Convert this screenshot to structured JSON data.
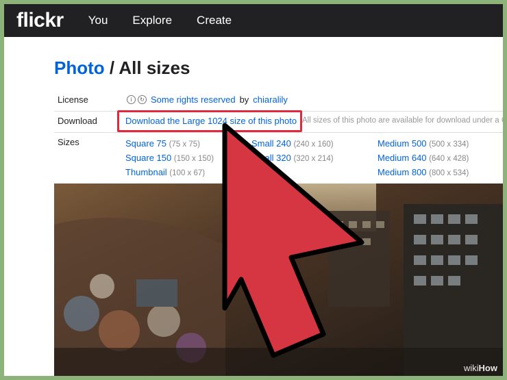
{
  "nav": {
    "logo": "flickr",
    "items": [
      "You",
      "Explore",
      "Create"
    ]
  },
  "page": {
    "title_link": "Photo",
    "title_sep": " / ",
    "title_rest": "All sizes"
  },
  "license": {
    "label": "License",
    "icons": [
      "cc-attribution-icon",
      "cc-sharealike-icon"
    ],
    "link": "Some rights reserved",
    "by": "by",
    "author": "chiaralily"
  },
  "download": {
    "label": "Download",
    "link": "Download the Large 1024 size of this photo",
    "note": "All sizes of this photo are available for download under a C"
  },
  "sizes": {
    "label": "Sizes",
    "columns": [
      [
        {
          "name": "Square 75",
          "dims": "(75 x 75)"
        },
        {
          "name": "Square 150",
          "dims": "(150 x 150)"
        },
        {
          "name": "Thumbnail",
          "dims": "(100 x 67)"
        }
      ],
      [
        {
          "name": "Small 240",
          "dims": "(240 x 160)"
        },
        {
          "name": "Small 320",
          "dims": "(320 x 214)"
        }
      ],
      [
        {
          "name": "Medium 500",
          "dims": "(500 x 334)"
        },
        {
          "name": "Medium 640",
          "dims": "(640 x 428)"
        },
        {
          "name": "Medium 800",
          "dims": "(800 x 534)"
        }
      ]
    ]
  },
  "watermark": {
    "prefix": "wiki",
    "suffix": "How"
  },
  "colors": {
    "accent": "#0063dc",
    "highlight": "#dd2a3f",
    "navbar": "#212124",
    "border": "#8db37a"
  }
}
